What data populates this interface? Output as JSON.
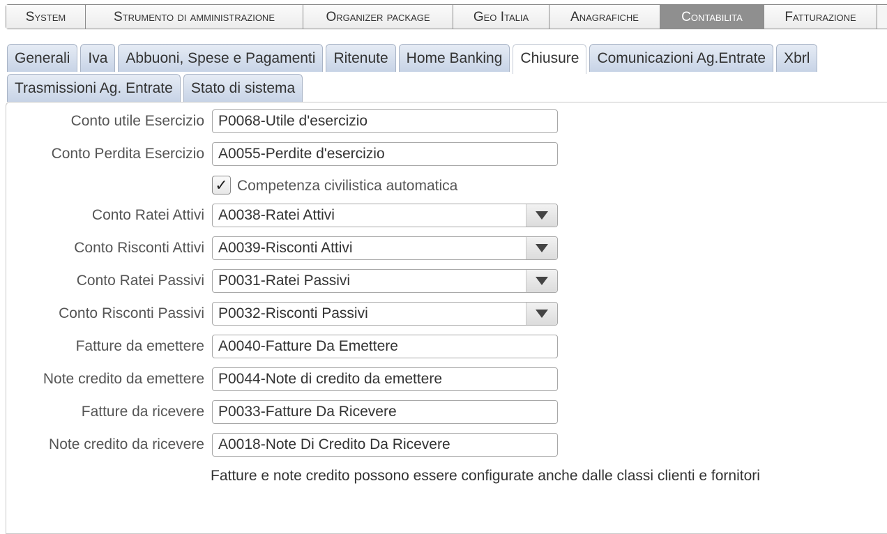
{
  "menu": {
    "items": [
      "System",
      "Strumento di amministrazione",
      "Organizer package",
      "Geo Italia",
      "Anagrafiche",
      "Contabilita",
      "Fatturazione"
    ],
    "active": "Contabilita"
  },
  "tabs": {
    "row1": [
      "Generali",
      "Iva",
      "Abbuoni, Spese e Pagamenti",
      "Ritenute",
      "Home Banking",
      "Chiusure",
      "Comunicazioni Ag.Entrate",
      "Xbrl"
    ],
    "row2": [
      "Trasmissioni Ag. Entrate",
      "Stato di sistema"
    ],
    "active": "Chiusure"
  },
  "form": {
    "conto_utile": {
      "label": "Conto utile Esercizio",
      "value": "P0068-Utile d'esercizio"
    },
    "conto_perdita": {
      "label": "Conto Perdita Esercizio",
      "value": "A0055-Perdite d'esercizio"
    },
    "competenza": {
      "label": "Competenza civilistica automatica",
      "checked": true,
      "check_glyph": "✓"
    },
    "ratei_attivi": {
      "label": "Conto Ratei Attivi",
      "value": "A0038-Ratei Attivi"
    },
    "risconti_attivi": {
      "label": "Conto Risconti Attivi",
      "value": "A0039-Risconti Attivi"
    },
    "ratei_passivi": {
      "label": "Conto Ratei Passivi",
      "value": "P0031-Ratei Passivi"
    },
    "risconti_passivi": {
      "label": "Conto Risconti Passivi",
      "value": "P0032-Risconti Passivi"
    },
    "fatture_emettere": {
      "label": "Fatture da emettere",
      "value": "A0040-Fatture Da Emettere"
    },
    "note_emettere": {
      "label": "Note credito da emettere",
      "value": "P0044-Note di credito da emettere"
    },
    "fatture_ricevere": {
      "label": "Fatture da ricevere",
      "value": "P0033-Fatture Da Ricevere"
    },
    "note_ricevere": {
      "label": "Note credito da ricevere",
      "value": "A0018-Note Di Credito Da Ricevere"
    }
  },
  "note": "Fatture e note credito possono essere configurate anche dalle classi clienti e fornitori",
  "colors": {
    "active_menu": "#8f8f8f",
    "tab_bg": "#c7d3e6"
  },
  "icons": {
    "dropdown": "chevron-down-icon",
    "check": "checkmark-icon"
  }
}
